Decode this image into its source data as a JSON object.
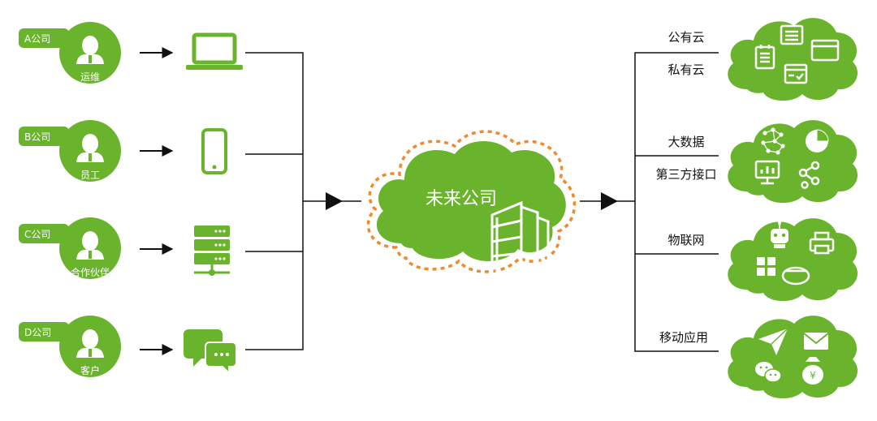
{
  "colors": {
    "green": "#6ab42d",
    "line": "#222222",
    "dash": "#f08a2c",
    "white": "#ffffff"
  },
  "sources": [
    {
      "company": "A公司",
      "role": "运维",
      "device_icon": "laptop-icon"
    },
    {
      "company": "B公司",
      "role": "员工",
      "device_icon": "smartphone-icon"
    },
    {
      "company": "C公司",
      "role": "合作伙伴",
      "device_icon": "server-icon"
    },
    {
      "company": "D公司",
      "role": "客户",
      "device_icon": "chat-icon"
    }
  ],
  "center": {
    "label": "未来公司",
    "icon": "building-icon"
  },
  "targets": [
    {
      "labels": [
        "公有云",
        "私有云"
      ],
      "icons": [
        "list-card-icon",
        "notepad-icon",
        "browser-window-icon",
        "check-list-icon"
      ]
    },
    {
      "labels": [
        "大数据",
        "第三方接口"
      ],
      "icons": [
        "network-dots-icon",
        "pie-chart-icon",
        "monitor-chart-icon",
        "share-nodes-icon"
      ]
    },
    {
      "labels": [
        "物联网"
      ],
      "icons": [
        "robot-icon",
        "printer-icon",
        "calculator-icon",
        "cooker-icon"
      ]
    },
    {
      "labels": [
        "移动应用"
      ],
      "icons": [
        "paper-plane-icon",
        "mail-icon",
        "wechat-icon",
        "money-bag-icon"
      ]
    }
  ]
}
